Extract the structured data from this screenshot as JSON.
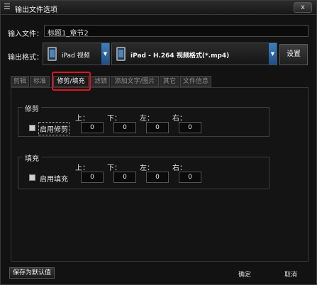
{
  "window": {
    "title": "输出文件选项",
    "close_label": "x"
  },
  "input_file": {
    "label": "输入文件：",
    "value": "标题1_章节2"
  },
  "output_format": {
    "label": "输出格式：",
    "device": "iPad 视频",
    "format": "iPad - H.264 视频格式(*.mp4)"
  },
  "settings_button": "设置",
  "tabs": [
    {
      "label": "剪辑"
    },
    {
      "label": "标准"
    },
    {
      "label": "修剪/填充"
    },
    {
      "label": "滤镜"
    },
    {
      "label": "添加文字/图片"
    },
    {
      "label": "其它"
    },
    {
      "label": "文件信息"
    }
  ],
  "active_tab": "修剪/填充",
  "trim": {
    "title": "修剪",
    "checkbox_label": "启用修剪",
    "top_label": "上：",
    "bottom_label": "下：",
    "left_label": "左：",
    "right_label": "右：",
    "top": "0",
    "bottom": "0",
    "left": "0",
    "right": "0"
  },
  "pad": {
    "title": "填充",
    "checkbox_label": "启用填充",
    "top_label": "上：",
    "bottom_label": "下：",
    "left_label": "左：",
    "right_label": "右：",
    "top": "0",
    "bottom": "0",
    "left": "0",
    "right": "0"
  },
  "footer": {
    "save_default": "保存为默认值",
    "ok": "确定",
    "cancel": "取消"
  },
  "icons": {
    "menu": "menu-icon",
    "device": "tablet-icon",
    "dropdown": "chevron-down-icon"
  }
}
